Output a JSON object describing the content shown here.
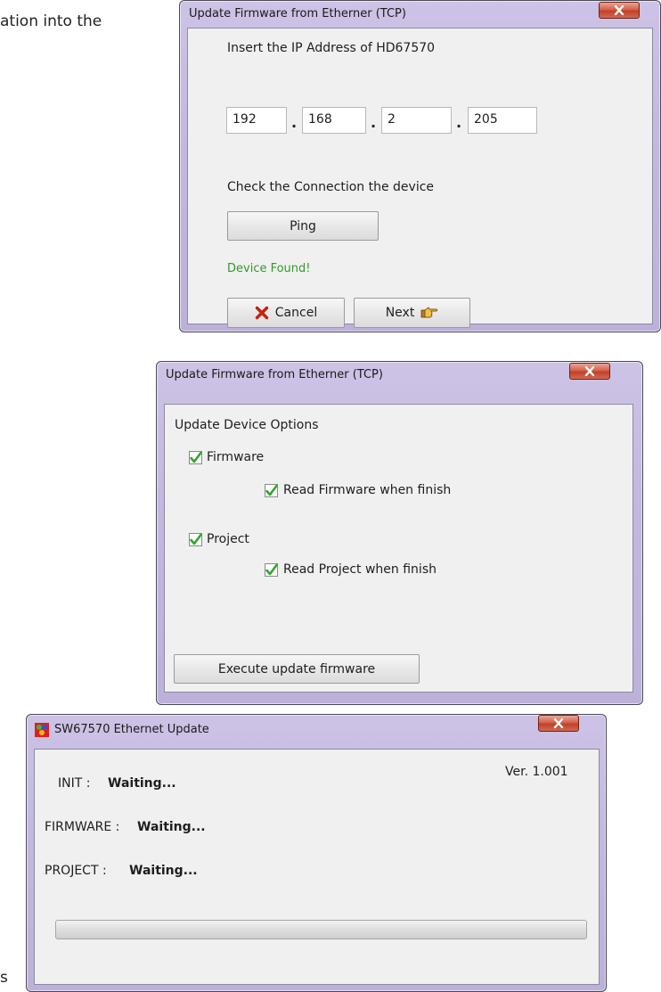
{
  "background": {
    "top_text": "ation into the",
    "bottom_text": "s"
  },
  "dialog1": {
    "title": "Update Firmware from Etherner (TCP)",
    "ip_label": "Insert the IP Address of HD67570",
    "ip": [
      "192",
      "168",
      "2",
      "205"
    ],
    "ip_separator": ".",
    "check_label": "Check the Connection the device",
    "ping_label": "Ping",
    "status": "Device Found!",
    "cancel_label": "Cancel",
    "next_label": "Next"
  },
  "dialog2": {
    "title": "Update Firmware from Etherner (TCP)",
    "section_label": "Update Device Options",
    "options": {
      "firmware": {
        "label": "Firmware",
        "checked": true
      },
      "read_firmware": {
        "label": "Read Firmware when finish",
        "checked": true
      },
      "project": {
        "label": "Project",
        "checked": true
      },
      "read_project": {
        "label": "Read Project when finish",
        "checked": true
      }
    },
    "execute_label": "Execute update firmware"
  },
  "dialog3": {
    "title": "SW67570 Ethernet Update",
    "version": "Ver. 1.001",
    "init_label": "INIT :",
    "init_value": "Waiting...",
    "firmware_label": "FIRMWARE :",
    "firmware_value": "Waiting...",
    "project_label": "PROJECT :",
    "project_value": "Waiting...",
    "progress": 0
  },
  "colors": {
    "status_found": "#2f9b27",
    "close_button": "#c9482f",
    "check_green": "#2ea82a"
  }
}
